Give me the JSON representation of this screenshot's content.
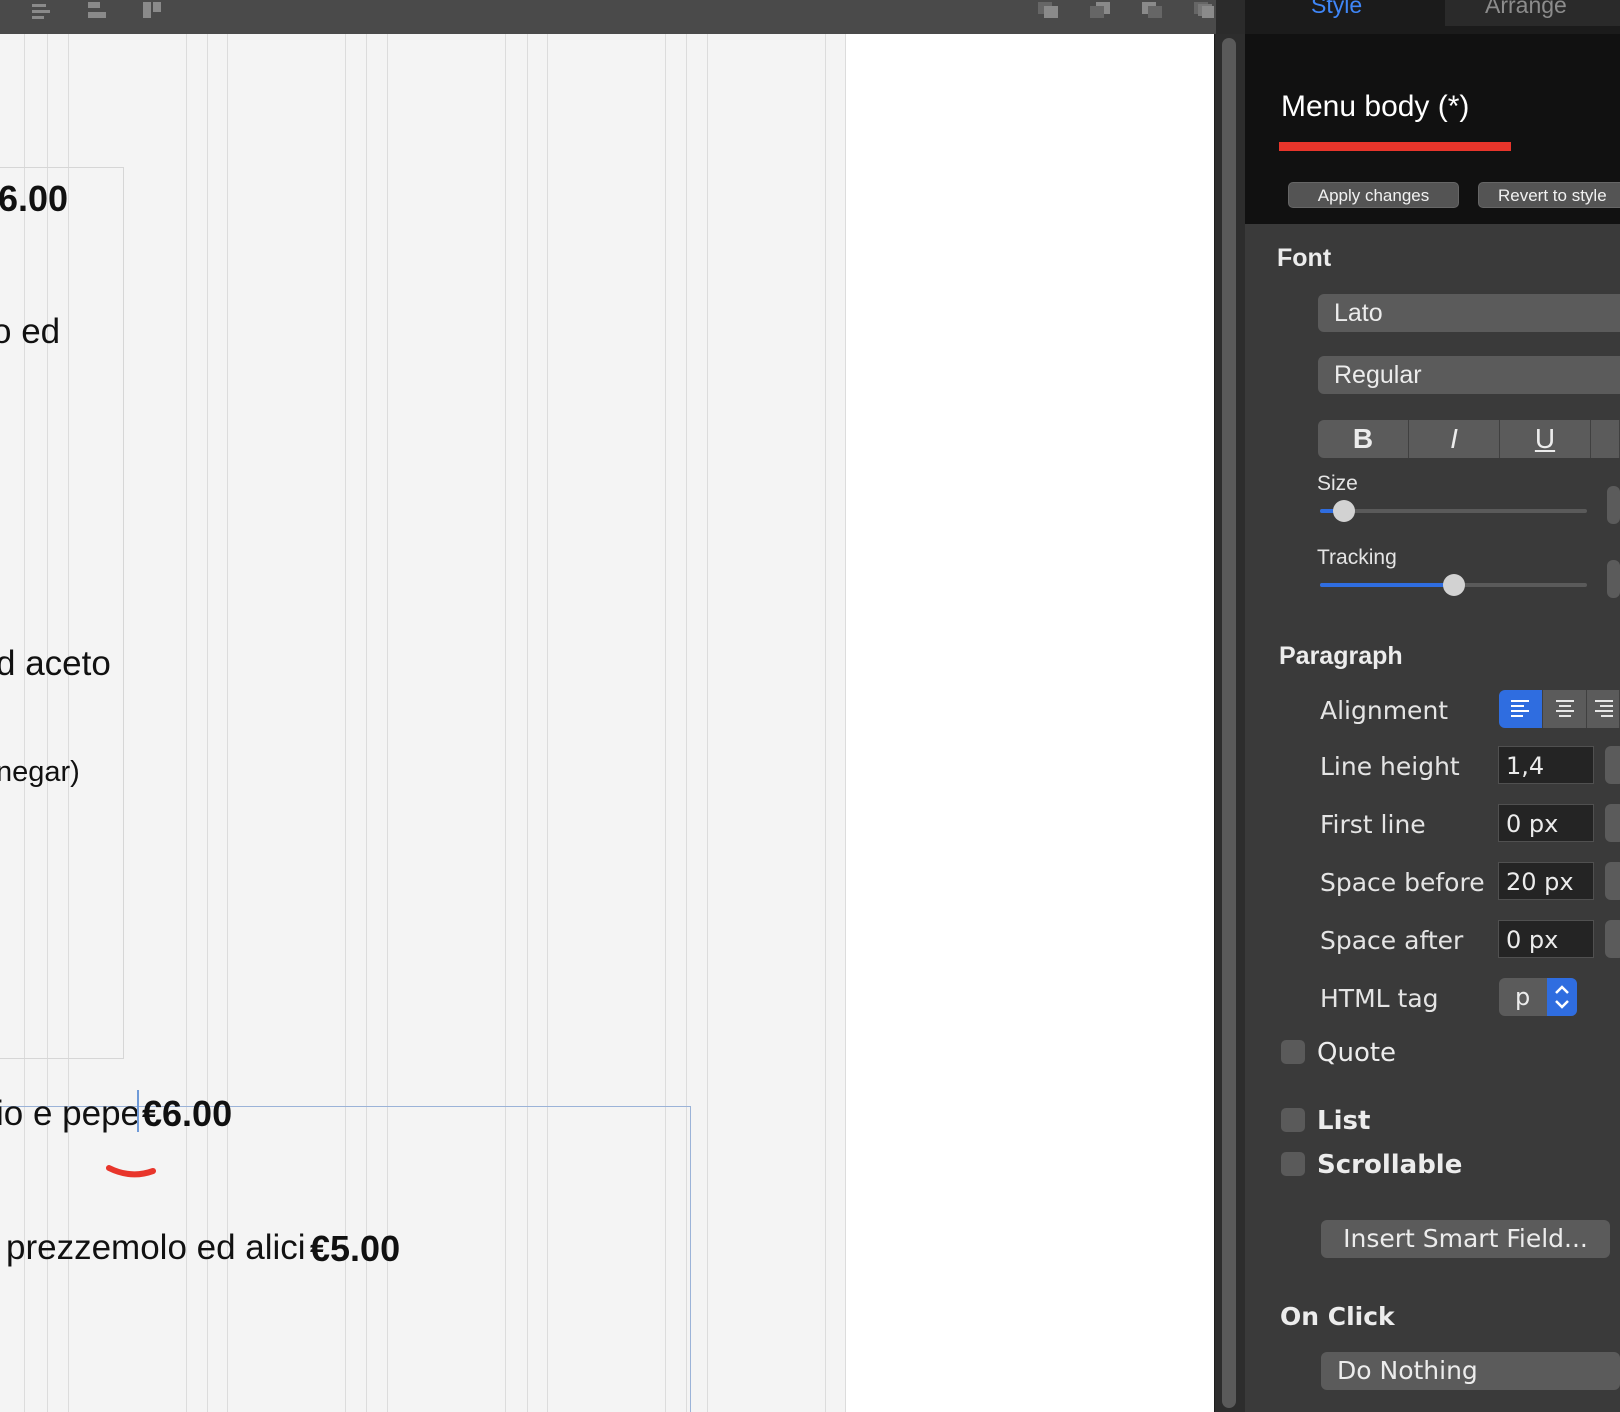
{
  "canvas": {
    "text": {
      "price_top": "6.00",
      "frag_ed": "o ed",
      "frag_aceto": "d aceto",
      "frag_negar": "negar)",
      "line1_text": "io e pepe",
      "line1_price": "€6.00",
      "line2_text": "prezzemolo ed alici",
      "line2_price": "€5.00"
    }
  },
  "inspector": {
    "tabs": {
      "style": "Style",
      "arrange": "Arrange"
    },
    "style_name": "Menu body (*)",
    "apply_label": "Apply changes",
    "revert_label": "Revert to style",
    "font": {
      "heading": "Font",
      "family": "Lato",
      "weight": "Regular",
      "bold": "B",
      "italic": "I",
      "underline": "U",
      "size_label": "Size",
      "size_level": 0.09,
      "tracking_label": "Tracking",
      "tracking_level": 0.5
    },
    "paragraph": {
      "heading": "Paragraph",
      "alignment_label": "Alignment",
      "alignment_selected": "left",
      "line_height_label": "Line height",
      "line_height_value": "1,4",
      "first_line_label": "First line",
      "first_line_value": "0 px",
      "space_before_label": "Space before",
      "space_before_value": "20 px",
      "space_after_label": "Space after",
      "space_after_value": "0 px",
      "html_tag_label": "HTML tag",
      "html_tag_value": "p"
    },
    "checkboxes": {
      "quote": "Quote",
      "list": "List",
      "scrollable": "Scrollable"
    },
    "insert_smart_field": "Insert Smart Field...",
    "on_click": {
      "heading": "On Click",
      "value": "Do Nothing"
    }
  },
  "colors": {
    "accent_blue": "#2f6de0",
    "style_tab_blue": "#3f86f7",
    "underline_red": "#e8352b"
  }
}
